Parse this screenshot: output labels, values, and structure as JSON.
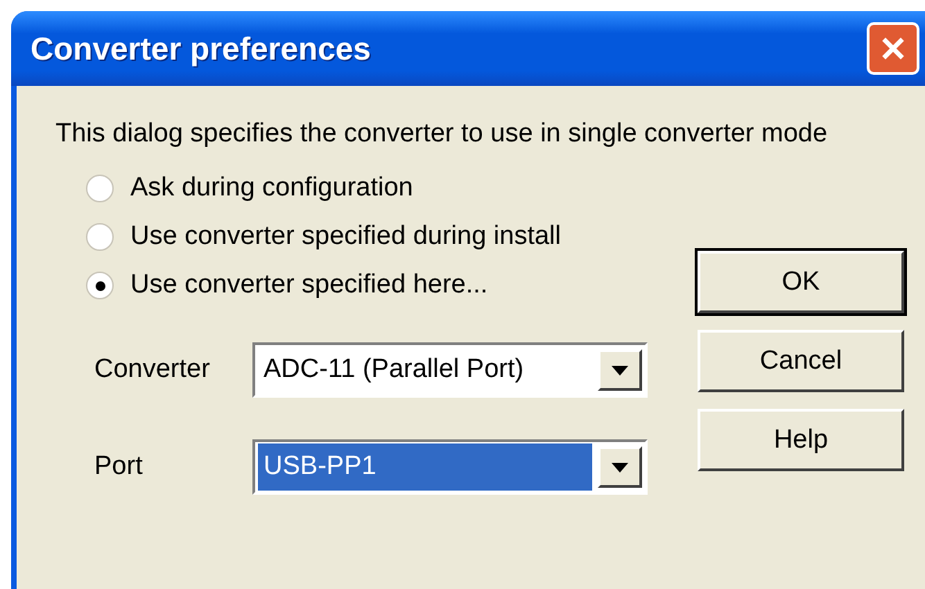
{
  "window": {
    "title": "Converter preferences"
  },
  "description": "This dialog specifies the converter to use in single converter mode",
  "options": [
    {
      "label": "Ask during configuration",
      "selected": false
    },
    {
      "label": "Use converter specified during install",
      "selected": false
    },
    {
      "label": "Use converter specified here...",
      "selected": true
    }
  ],
  "fields": [
    {
      "label": "Converter",
      "value": "ADC-11 (Parallel Port)",
      "highlighted": false
    },
    {
      "label": "Port",
      "value": "USB-PP1",
      "highlighted": true
    }
  ],
  "buttons": [
    {
      "label": "OK",
      "default": true
    },
    {
      "label": "Cancel",
      "default": false
    },
    {
      "label": "Help",
      "default": false
    }
  ]
}
